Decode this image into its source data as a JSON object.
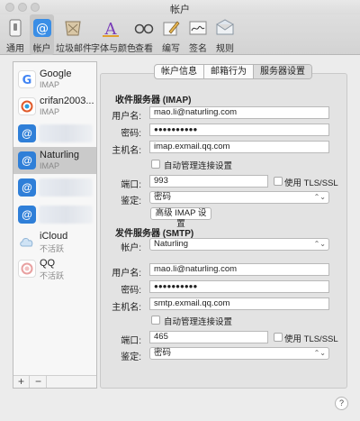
{
  "window": {
    "title": "帐户"
  },
  "toolbar": {
    "items": [
      {
        "label": "通用",
        "icon": "switch-icon"
      },
      {
        "label": "帐户",
        "icon": "at-icon"
      },
      {
        "label": "垃圾邮件",
        "icon": "junk-icon"
      },
      {
        "label": "字体与颜色",
        "icon": "font-icon"
      },
      {
        "label": "查看",
        "icon": "glasses-icon"
      },
      {
        "label": "编写",
        "icon": "pencil-icon"
      },
      {
        "label": "签名",
        "icon": "signature-icon"
      },
      {
        "label": "规则",
        "icon": "rules-icon"
      }
    ]
  },
  "sidebar": {
    "accounts": [
      {
        "name": "Google",
        "sub": "IMAP"
      },
      {
        "name": "crifan2003...",
        "sub": "IMAP"
      },
      {
        "name": "",
        "sub": ""
      },
      {
        "name": "Naturling",
        "sub": "IMAP"
      },
      {
        "name": "",
        "sub": ""
      },
      {
        "name": "",
        "sub": ""
      },
      {
        "name": "iCloud",
        "sub": "不活跃"
      },
      {
        "name": "QQ",
        "sub": "不活跃"
      }
    ],
    "add_label": "+",
    "remove_label": "−"
  },
  "tabs": [
    "帐户信息",
    "邮箱行为",
    "服务器设置"
  ],
  "incoming": {
    "heading": "收件服务器 (IMAP)",
    "username_label": "用户名:",
    "username": "mao.li@naturling.com",
    "password_label": "密码:",
    "password": "●●●●●●●●●●",
    "host_label": "主机名:",
    "host": "imap.exmail.qq.com",
    "auto_manage": "自动管理连接设置",
    "port_label": "端口:",
    "port": "993",
    "tls_label": "使用 TLS/SSL",
    "auth_label": "鉴定:",
    "auth": "密码",
    "advanced_button": "高级 IMAP 设置"
  },
  "outgoing": {
    "heading": "发件服务器 (SMTP)",
    "account_label": "帐户:",
    "account": "Naturling",
    "username_label": "用户名:",
    "username": "mao.li@naturling.com",
    "password_label": "密码:",
    "password": "●●●●●●●●●●",
    "host_label": "主机名:",
    "host": "smtp.exmail.qq.com",
    "auto_manage": "自动管理连接设置",
    "port_label": "端口:",
    "port": "465",
    "tls_label": "使用 TLS/SSL",
    "auth_label": "鉴定:",
    "auth": "密码"
  },
  "help_label": "?"
}
